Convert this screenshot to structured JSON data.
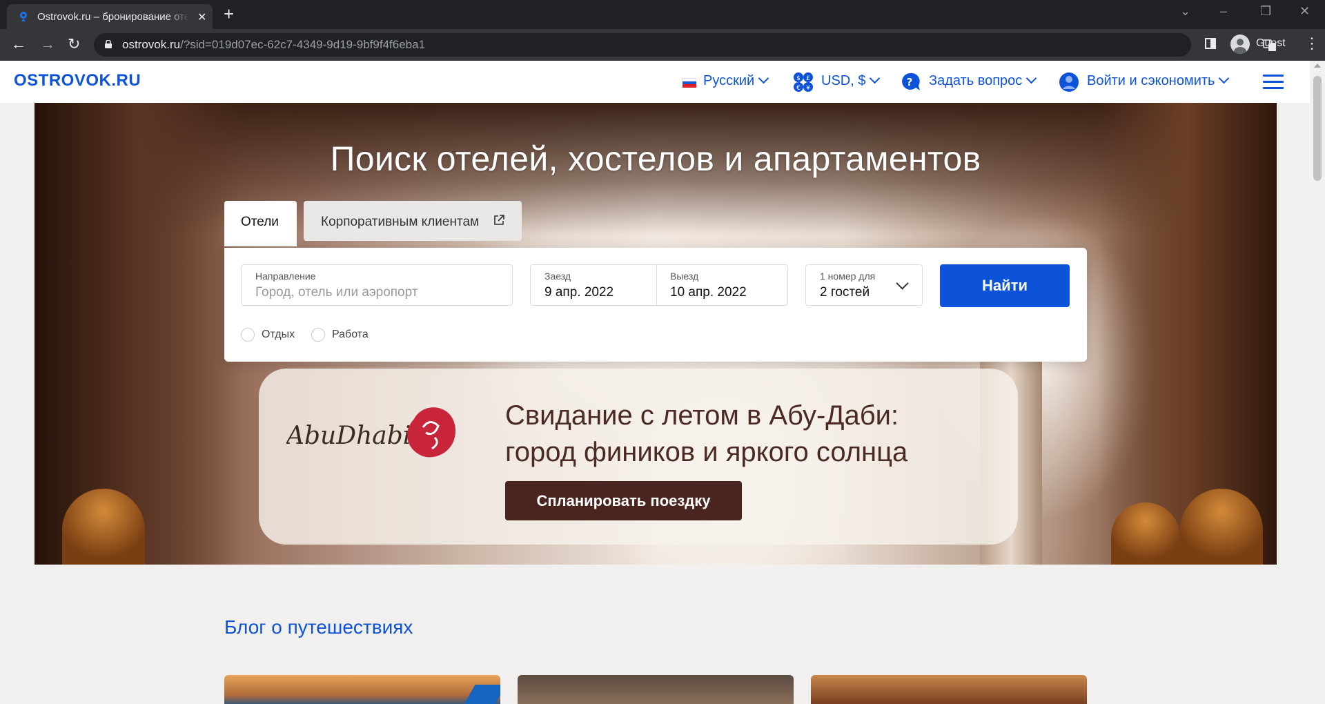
{
  "browser": {
    "tab_title": "Ostrovok.ru – бронирование отелей",
    "url_host": "ostrovok.ru",
    "url_path": "/?sid=019d07ec-62c7-4349-9d19-9bf9f4f6eba1",
    "profile_label": "Guest"
  },
  "header": {
    "logo": "OSTROVOK.RU",
    "language": "Русский",
    "currency": "USD, $",
    "help": "Задать вопрос",
    "login": "Войти и сэкономить"
  },
  "hero": {
    "title": "Поиск отелей, хостелов и апартаментов"
  },
  "search": {
    "tabs": {
      "hotels": "Отели",
      "corporate": "Корпоративным клиентам"
    },
    "destination": {
      "label": "Направление",
      "placeholder": "Город, отель или аэропорт"
    },
    "checkin": {
      "label": "Заезд",
      "value": "9 апр. 2022"
    },
    "checkout": {
      "label": "Выезд",
      "value": "10 апр. 2022"
    },
    "guests": {
      "label": "1 номер для",
      "value": "2 гостей"
    },
    "submit": "Найти",
    "purpose": {
      "leisure": "Отдых",
      "work": "Работа"
    }
  },
  "promo": {
    "logo_text": "AbuDhabi",
    "title_line1": "Свидание с летом в Абу-Даби:",
    "title_line2": "город фиников и яркого солнца",
    "button": "Спланировать поездку"
  },
  "blog": {
    "title": "Блог о путешествиях"
  },
  "colors": {
    "brand_blue": "#0d53d9",
    "promo_brown": "#4a2520"
  }
}
